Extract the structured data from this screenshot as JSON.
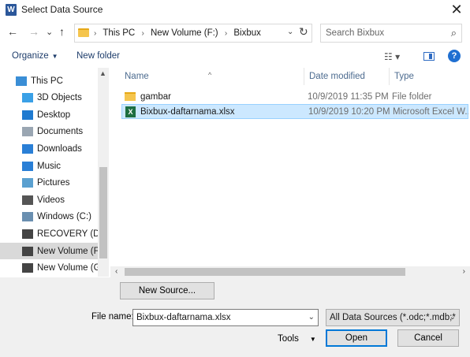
{
  "window": {
    "title": "Select Data Source",
    "app_icon_letter": "W",
    "close_glyph": "✕"
  },
  "nav": {
    "back_glyph": "←",
    "forward_glyph": "→",
    "recent_glyph": "⌄",
    "up_glyph": "↑",
    "breadcrumbs": [
      "This PC",
      "New Volume (F:)",
      "Bixbux"
    ],
    "search_placeholder": "Search Bixbux"
  },
  "commands": {
    "organize": "Organize",
    "new_folder": "New folder"
  },
  "sidebar": {
    "items": [
      {
        "label": "This PC",
        "icon": "computer-icon",
        "color": "#3a8ed6"
      },
      {
        "label": "3D Objects",
        "icon": "cube-icon",
        "color": "#3aa0e6"
      },
      {
        "label": "Desktop",
        "icon": "desktop-icon",
        "color": "#1f7ad0"
      },
      {
        "label": "Documents",
        "icon": "document-icon",
        "color": "#9aa6b2"
      },
      {
        "label": "Downloads",
        "icon": "download-icon",
        "color": "#2a7fd6"
      },
      {
        "label": "Music",
        "icon": "music-icon",
        "color": "#2a7fd6"
      },
      {
        "label": "Pictures",
        "icon": "pictures-icon",
        "color": "#5aa0d0"
      },
      {
        "label": "Videos",
        "icon": "videos-icon",
        "color": "#555555"
      },
      {
        "label": "Windows (C:)",
        "icon": "drive-windows-icon",
        "color": "#6a8fb0"
      },
      {
        "label": "RECOVERY (D:)",
        "icon": "drive-icon",
        "color": "#444444"
      },
      {
        "label": "New Volume (F:)",
        "icon": "drive-icon",
        "color": "#444444",
        "selected": true
      },
      {
        "label": "New Volume (G:",
        "icon": "drive-icon",
        "color": "#444444"
      }
    ]
  },
  "files": {
    "columns": [
      "Name",
      "Date modified",
      "Type"
    ],
    "rows": [
      {
        "name": "gambar",
        "date": "10/9/2019 11:35 PM",
        "type": "File folder",
        "icon": "folder-icon"
      },
      {
        "name": "Bixbux-daftarnama.xlsx",
        "date": "10/9/2019 10:20 PM",
        "type": "Microsoft Excel W...",
        "icon": "excel-file-icon",
        "selected": true
      }
    ]
  },
  "footer": {
    "new_source": "New Source...",
    "file_name_label": "File name:",
    "file_name_value": "Bixbux-daftarnama.xlsx",
    "filter_value": "All Data Sources (*.odc;*.mdb;*",
    "tools": "Tools",
    "open": "Open",
    "cancel": "Cancel"
  }
}
